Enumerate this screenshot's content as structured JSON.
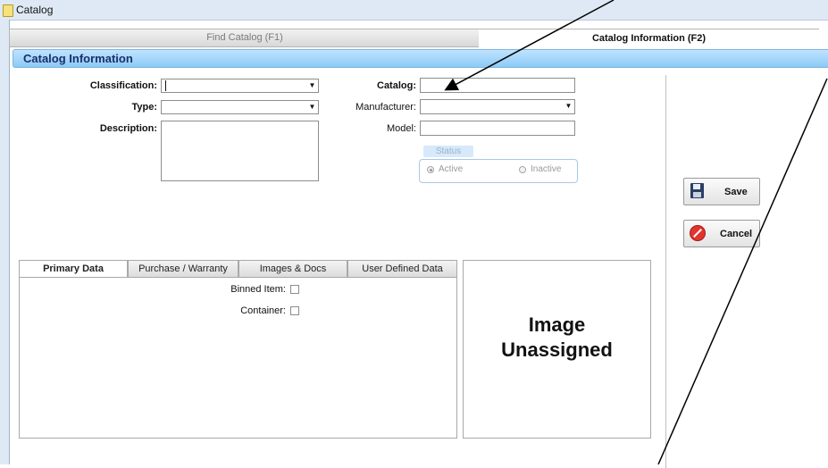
{
  "window": {
    "title": "Catalog"
  },
  "tabs": [
    {
      "label": "Find Catalog (F1)",
      "active": false
    },
    {
      "label": "Catalog Information (F2)",
      "active": true
    }
  ],
  "section": {
    "title": "Catalog Information"
  },
  "form": {
    "classification": {
      "label": "Classification:",
      "value": ""
    },
    "type": {
      "label": "Type:",
      "value": ""
    },
    "description": {
      "label": "Description:",
      "value": ""
    },
    "catalog": {
      "label": "Catalog:",
      "value": ""
    },
    "manufacturer": {
      "label": "Manufacturer:",
      "value": ""
    },
    "model": {
      "label": "Model:",
      "value": ""
    }
  },
  "status": {
    "legend": "Status",
    "options": [
      {
        "label": "Active",
        "selected": true
      },
      {
        "label": "Inactive",
        "selected": false
      }
    ]
  },
  "buttons": {
    "save": "Save",
    "cancel": "Cancel"
  },
  "inner_tabs": [
    "Primary Data",
    "Purchase / Warranty",
    "Images & Docs",
    "User Defined Data"
  ],
  "primary_data": {
    "binned_item": {
      "label": "Binned Item:",
      "checked": false
    },
    "container": {
      "label": "Container:",
      "checked": false
    }
  },
  "image_panel": {
    "line1": "Image",
    "line2": "Unassigned"
  },
  "colors": {
    "header_blue": "#8ccaf7",
    "header_text": "#1a2f6b",
    "cancel_red": "#e2332e"
  },
  "icons": {
    "app": "notebook-icon",
    "save": "floppy-disk-icon",
    "cancel": "no-entry-icon"
  }
}
